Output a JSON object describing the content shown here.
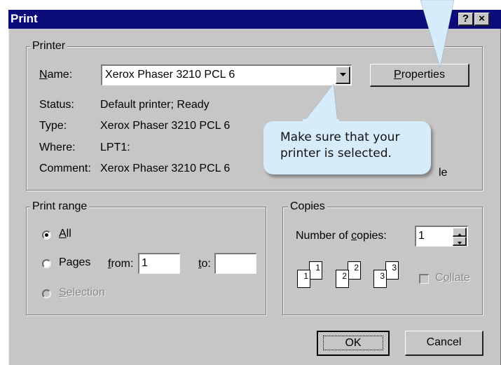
{
  "window": {
    "title": "Print",
    "help_button": "?",
    "close_button": "×"
  },
  "printer_group": {
    "legend": "Printer",
    "name_label_underlined": "N",
    "name_label_rest": "ame:",
    "selected_printer": "Xerox Phaser 3210 PCL 6",
    "properties_button_underlined": "P",
    "properties_button_rest": "roperties",
    "status_label": "Status:",
    "status_value": "Default printer; Ready",
    "type_label": "Type:",
    "type_value": "Xerox Phaser 3210 PCL 6",
    "where_label": "Where:",
    "where_value": "LPT1:",
    "comment_label": "Comment:",
    "comment_value": "Xerox Phaser 3210 PCL 6",
    "print_to_file_visible_fragment": "le"
  },
  "print_range": {
    "legend": "Print range",
    "all_underlined": "A",
    "all_rest": "ll",
    "all_selected": true,
    "pages_label": "Pages",
    "from_label_underlined": "f",
    "from_label_rest": "rom:",
    "from_value": "1",
    "to_label_underlined": "t",
    "to_label_rest": "o:",
    "to_value": "",
    "selection_underlined": "S",
    "selection_rest": "election"
  },
  "copies": {
    "legend": "Copies",
    "number_label_prefix": "Number of ",
    "number_label_underlined": "c",
    "number_label_suffix": "opies:",
    "number_value": "1",
    "collate_underlined": "o",
    "collate_prefix": "C",
    "collate_rest": "llate",
    "collate_checked": false,
    "collate_icon_pages": [
      {
        "back": "1",
        "front": "1"
      },
      {
        "back": "2",
        "front": "2"
      },
      {
        "back": "3",
        "front": "3"
      }
    ]
  },
  "buttons": {
    "ok": "OK",
    "cancel": "Cancel"
  },
  "callout": {
    "text": "Make sure that your\nprinter is selected.",
    "color": "#d7ecfb"
  },
  "icons": {
    "dropdown": "chevron-down-icon",
    "spin": "spin-up-down-icon"
  }
}
